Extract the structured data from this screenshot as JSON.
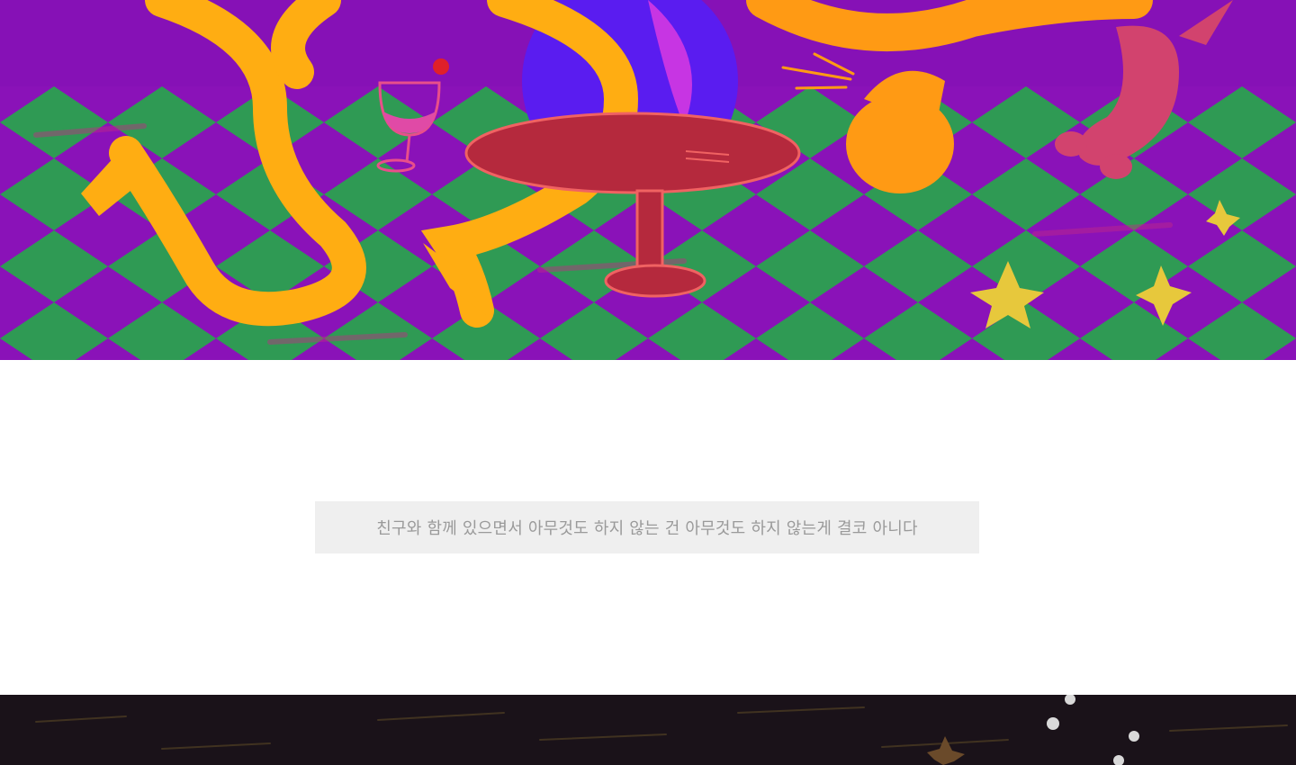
{
  "hero": {
    "illustration": "surreal-party-illustration"
  },
  "quote": {
    "text": "친구와 함께 있으면서 아무것도 하지 않는 건 아무것도 하지 않는게 결코 아니다"
  },
  "footer_art": {
    "illustration": "night-sky-illustration"
  },
  "colors": {
    "purple": "#8a12b8",
    "green": "#2f9a54",
    "orange": "#ffa600",
    "red_table": "#b8283c",
    "quote_bg": "#efefef",
    "quote_text": "#9a9a9a",
    "dark_bg": "#1a1219"
  }
}
